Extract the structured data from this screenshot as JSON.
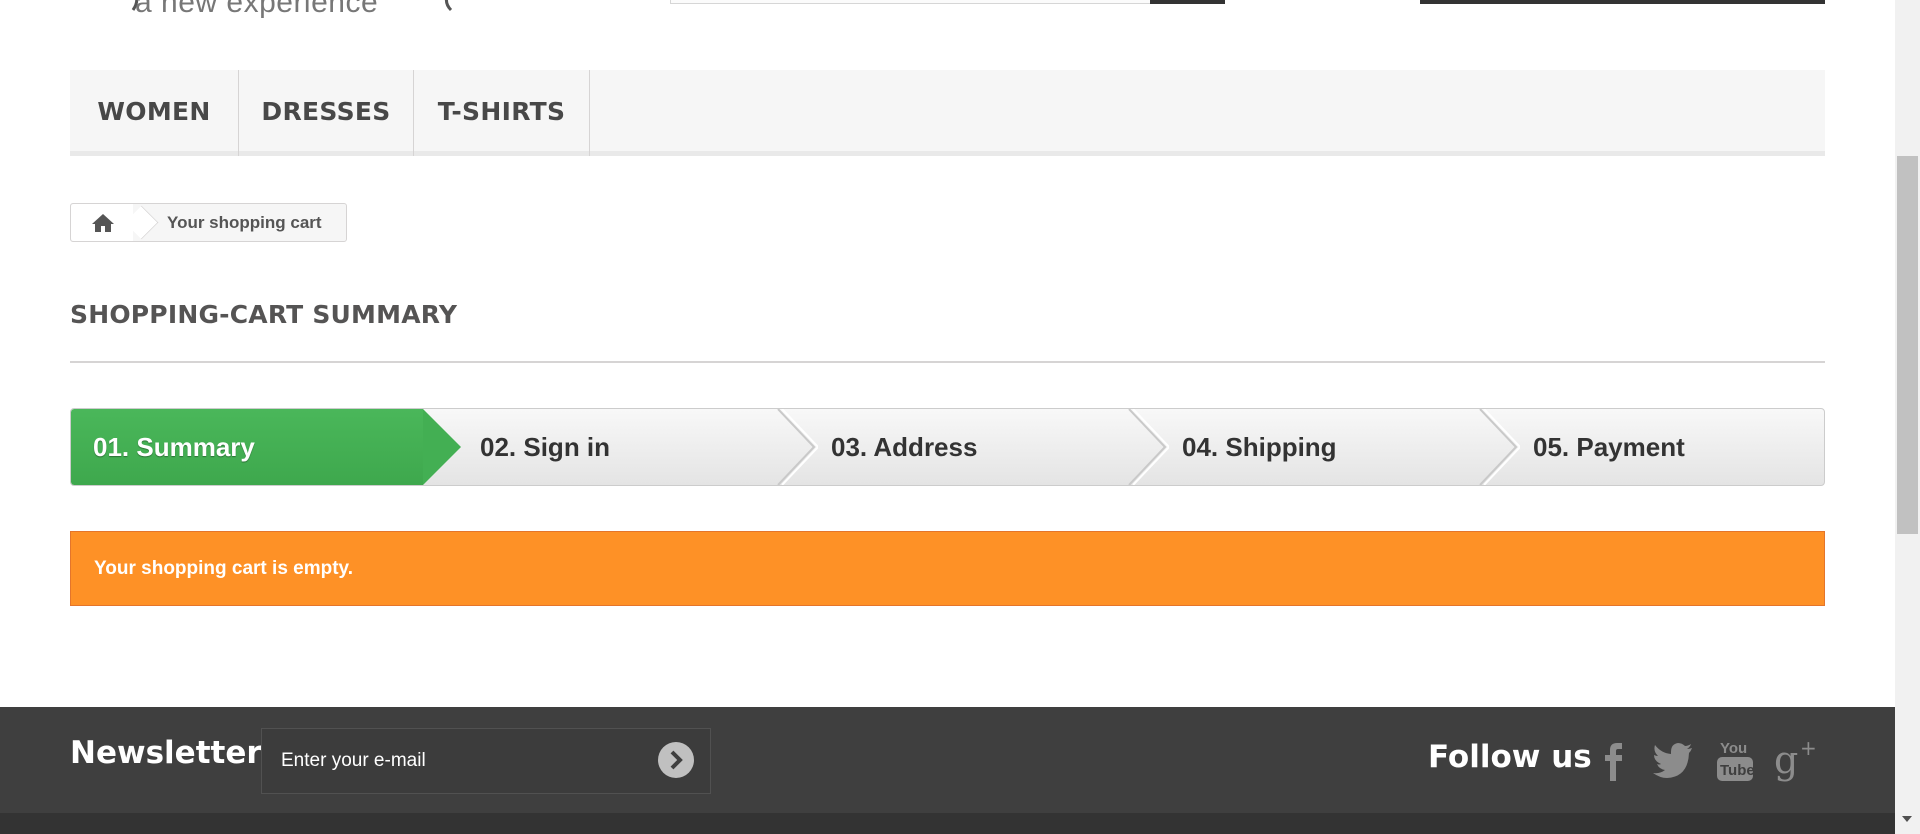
{
  "header": {
    "tagline": "a new experience"
  },
  "menu": {
    "items": [
      {
        "label": "WOMEN"
      },
      {
        "label": "DRESSES"
      },
      {
        "label": "T-SHIRTS"
      }
    ]
  },
  "breadcrumb": {
    "current": "Your shopping cart",
    "home_icon": "home-icon"
  },
  "page": {
    "heading": "SHOPPING-CART SUMMARY"
  },
  "steps": {
    "items": [
      {
        "label": "01. Summary",
        "active": true
      },
      {
        "label": "02. Sign in",
        "active": false
      },
      {
        "label": "03. Address",
        "active": false
      },
      {
        "label": "04. Shipping",
        "active": false
      },
      {
        "label": "05. Payment",
        "active": false
      }
    ],
    "active_color": "#46b258"
  },
  "alert": {
    "message": "Your shopping cart is empty.",
    "color": "#fe9126"
  },
  "footer": {
    "newsletter_title": "Newsletter",
    "newsletter_placeholder": "Enter your e-mail",
    "follow_title": "Follow us",
    "social_icons": [
      "facebook-icon",
      "twitter-icon",
      "youtube-icon",
      "google-plus-icon"
    ]
  }
}
